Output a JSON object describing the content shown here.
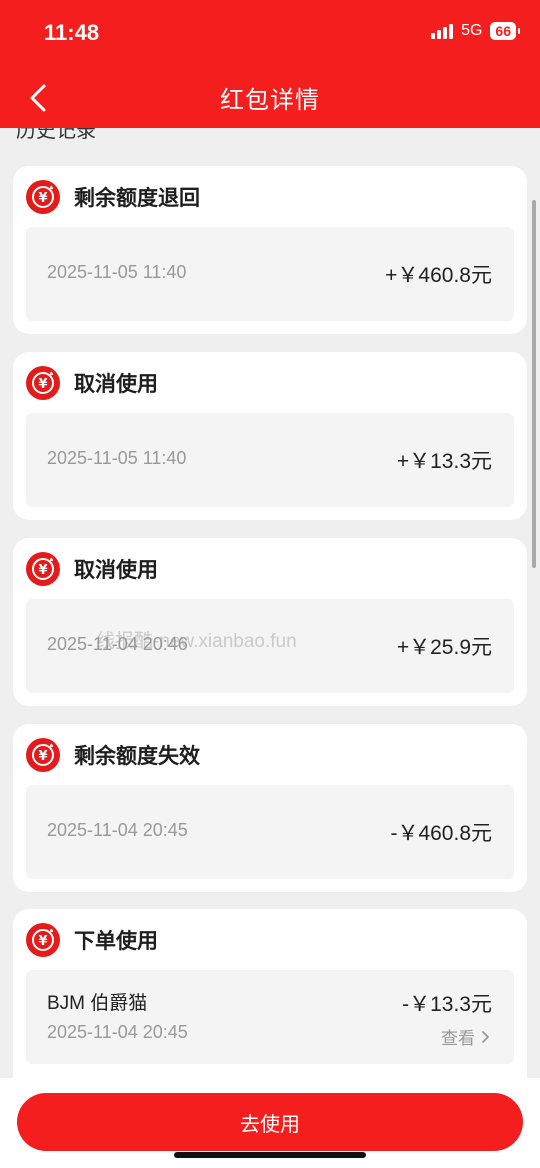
{
  "status_bar": {
    "time": "11:48",
    "network": "5G",
    "battery": "66"
  },
  "header": {
    "title": "红包详情",
    "back_icon": "chevron-left-icon"
  },
  "section": {
    "title": "历史记录"
  },
  "records": [
    {
      "title": "剩余额度退回",
      "date": "2025-11-05 11:40",
      "amount": "+￥460.8元"
    },
    {
      "title": "取消使用",
      "date": "2025-11-05 11:40",
      "amount": "+￥13.3元"
    },
    {
      "title": "取消使用",
      "date": "2025-11-04 20:46",
      "amount": "+￥25.9元"
    },
    {
      "title": "剩余额度失效",
      "date": "2025-11-04 20:45",
      "amount": "-￥460.8元"
    },
    {
      "title": "下单使用",
      "merchant": "BJM 伯爵猫",
      "date": "2025-11-04 20:45",
      "amount": "-￥13.3元",
      "link": "查看"
    }
  ],
  "watermark": "线报酷-new.xianbao.fun",
  "footer": {
    "button_label": "去使用"
  },
  "colors": {
    "brand_red": "#f51e1e",
    "background": "#efefef"
  }
}
